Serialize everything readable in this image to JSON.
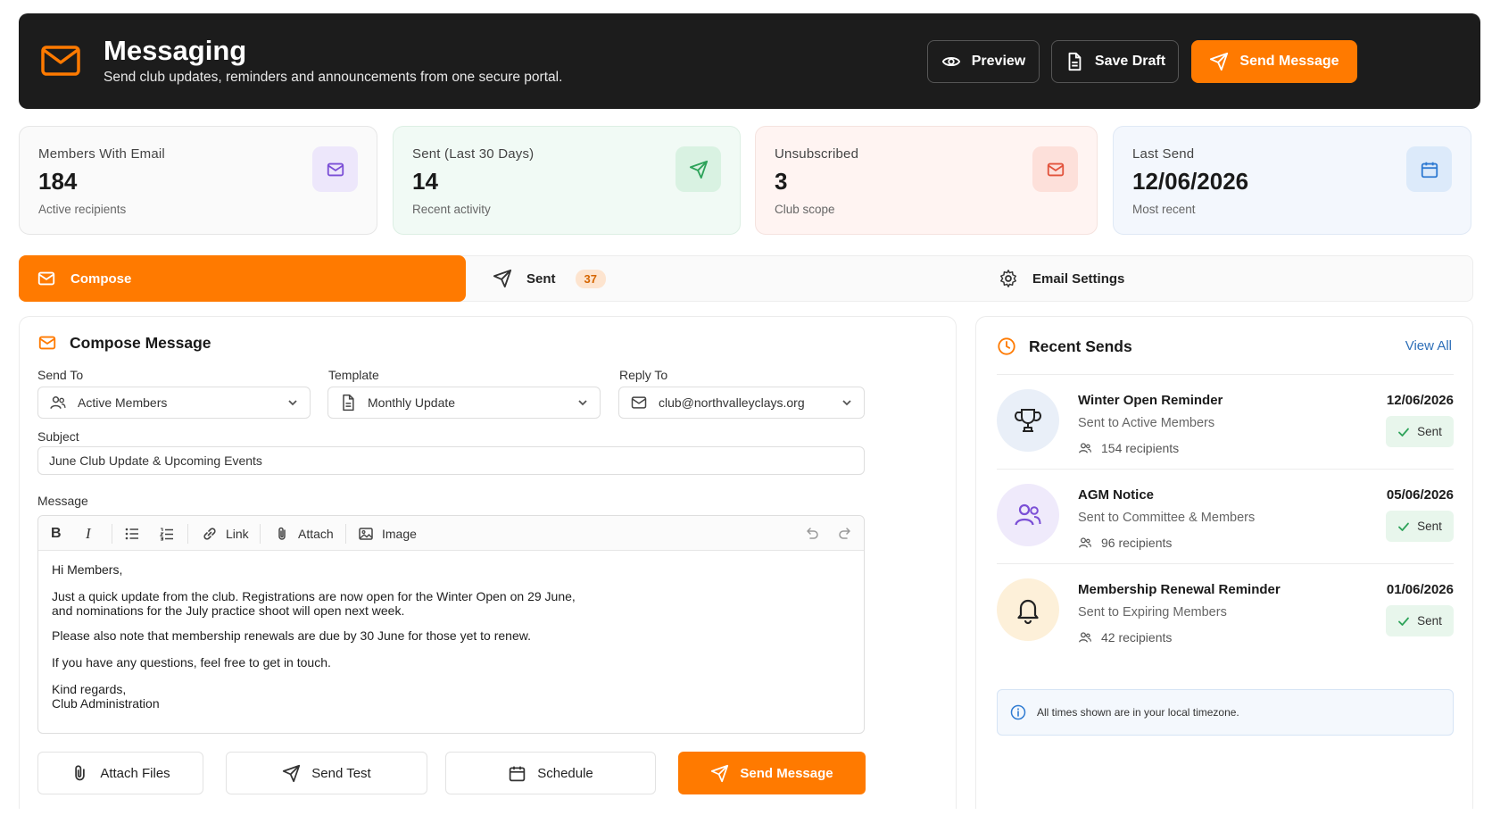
{
  "header": {
    "title": "Messaging",
    "subtitle": "Send club updates, reminders and announcements from one secure portal.",
    "preview_label": "Preview",
    "save_draft_label": "Save Draft",
    "send_label": "Send Message"
  },
  "colors": {
    "accent": "#ff7a00",
    "header_bg": "#1c1c1c",
    "link": "#2e6fb8"
  },
  "stats": [
    {
      "label": "Members With Email",
      "value": "184",
      "sub": "Active recipients",
      "icon": "mail-icon"
    },
    {
      "label": "Sent (Last 30 Days)",
      "value": "14",
      "sub": "Recent activity",
      "icon": "send-icon"
    },
    {
      "label": "Unsubscribed",
      "value": "3",
      "sub": "Club scope",
      "icon": "mail-icon"
    },
    {
      "label": "Last Send",
      "value": "12/06/2026",
      "sub": "Most recent",
      "icon": "calendar-icon"
    }
  ],
  "tabs": {
    "compose": "Compose",
    "sent": "Sent",
    "sent_count": "37",
    "settings": "Email Settings"
  },
  "compose": {
    "title": "Compose Message",
    "send_to_label": "Send To",
    "send_to_value": "Active Members",
    "template_label": "Template",
    "template_value": "Monthly Update",
    "reply_to_label": "Reply To",
    "reply_to_value": "club@northvalleyclays.org",
    "subject_label": "Subject",
    "subject_value": "June Club Update & Upcoming Events",
    "message_label": "Message",
    "toolbar": {
      "link": "Link",
      "attach": "Attach",
      "image": "Image"
    },
    "body": {
      "greeting": "Hi Members,",
      "p1_line1": "Just a quick update from the club. Registrations are now open for the Winter Open on 29 June,",
      "p1_line2": "and nominations for the July practice shoot will open next week.",
      "p2": "Please also note that membership renewals are due by 30 June for those yet to renew.",
      "p3": "If you have any questions, feel free to get in touch.",
      "signoff1": "Kind regards,",
      "signoff2": "Club Administration"
    },
    "actions": {
      "attach_files": "Attach Files",
      "send_test": "Send Test",
      "schedule": "Schedule",
      "send": "Send Message"
    }
  },
  "recent": {
    "title": "Recent Sends",
    "view_all": "View All",
    "items": [
      {
        "title": "Winter Open Reminder",
        "sub": "Sent to Active Members",
        "recipients": "154 recipients",
        "date": "12/06/2026",
        "status": "Sent",
        "icon": "trophy-icon"
      },
      {
        "title": "AGM Notice",
        "sub": "Sent to Committee & Members",
        "recipients": "96 recipients",
        "date": "05/06/2026",
        "status": "Sent",
        "icon": "users-icon"
      },
      {
        "title": "Membership Renewal Reminder",
        "sub": "Sent to Expiring Members",
        "recipients": "42 recipients",
        "date": "01/06/2026",
        "status": "Sent",
        "icon": "bell-icon"
      }
    ],
    "note": "All times shown are in your local timezone."
  }
}
